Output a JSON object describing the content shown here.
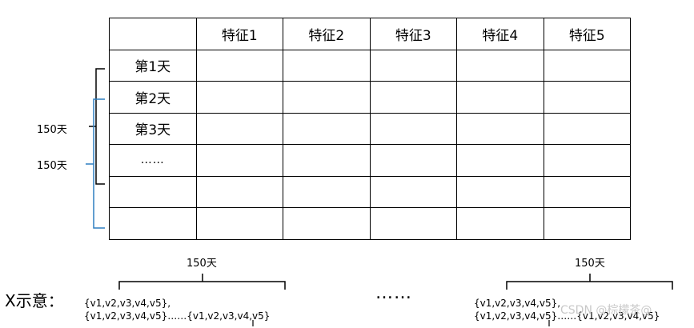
{
  "table": {
    "headers": [
      "",
      "特征1",
      "特征2",
      "特征3",
      "特征4",
      "特征5"
    ],
    "row_labels": [
      "第1天",
      "第2天",
      "第3天",
      "……",
      "",
      ""
    ]
  },
  "side_brackets": {
    "black_label": "150天",
    "blue_label": "150天",
    "black_color": "#000000",
    "blue_color": "#2f7fc1"
  },
  "bottom": {
    "x_label": "X示意：",
    "left_brace_label": "150天",
    "right_brace_label": "150天",
    "middle_dots": "……",
    "left_seq_line1": "{v1,v2,v3,v4,v5},",
    "left_seq_line2": "{v1,v2,v3,v4,v5}……{v1,v2,v3,v4,v5}",
    "right_seq_line1": "{v1,v2,v3,v4,v5},",
    "right_seq_line2": "{v1,v2,v3,v4,v5}……{v1,v2,v3,v4,v5}"
  },
  "watermark": "CSDN @棕檬茶@"
}
